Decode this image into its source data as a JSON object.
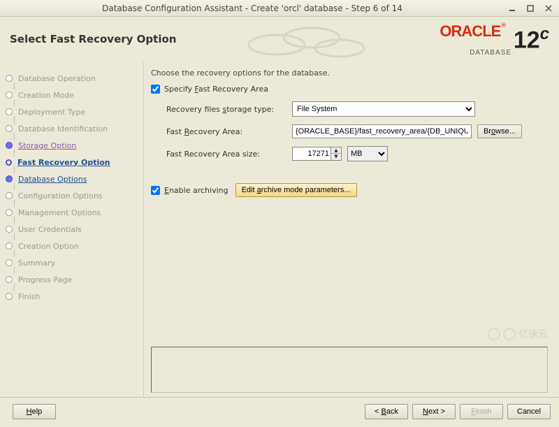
{
  "window": {
    "title": "Database Configuration Assistant - Create 'orcl' database - Step 6 of 14"
  },
  "header": {
    "heading": "Select Fast Recovery Option",
    "logo_brand": "ORACLE",
    "logo_sub": "DATABASE",
    "logo_version": "12",
    "logo_suffix": "c"
  },
  "steps": [
    {
      "label": "Database Operation",
      "state": "disabled"
    },
    {
      "label": "Creation Mode",
      "state": "disabled"
    },
    {
      "label": "Deployment Type",
      "state": "disabled"
    },
    {
      "label": "Database Identification",
      "state": "disabled"
    },
    {
      "label": "Storage Option",
      "state": "completed"
    },
    {
      "label": "Fast Recovery Option",
      "state": "active"
    },
    {
      "label": "Database Options",
      "state": "next"
    },
    {
      "label": "Configuration Options",
      "state": "disabled"
    },
    {
      "label": "Management Options",
      "state": "disabled"
    },
    {
      "label": "User Credentials",
      "state": "disabled"
    },
    {
      "label": "Creation Option",
      "state": "disabled"
    },
    {
      "label": "Summary",
      "state": "disabled"
    },
    {
      "label": "Progress Page",
      "state": "disabled"
    },
    {
      "label": "Finish",
      "state": "disabled"
    }
  ],
  "content": {
    "instruction": "Choose the recovery options for the database.",
    "specify_label": "Specify Fast Recovery Area",
    "specify_checked": true,
    "storage_type_label": "Recovery files storage type:",
    "storage_type_value": "File System",
    "fra_label": "Fast Recovery Area:",
    "fra_value": "{ORACLE_BASE}/fast_recovery_area/{DB_UNIQUE_",
    "browse_label": "Browse...",
    "size_label": "Fast Recovery Area size:",
    "size_value": "17271",
    "size_unit": "MB",
    "archive_label": "Enable archiving",
    "archive_checked": true,
    "archive_edit_label": "Edit archive mode parameters..."
  },
  "footer": {
    "help": "Help",
    "back": "< Back",
    "next": "Next >",
    "finish": "Finish",
    "cancel": "Cancel"
  },
  "watermark": "亿速云"
}
